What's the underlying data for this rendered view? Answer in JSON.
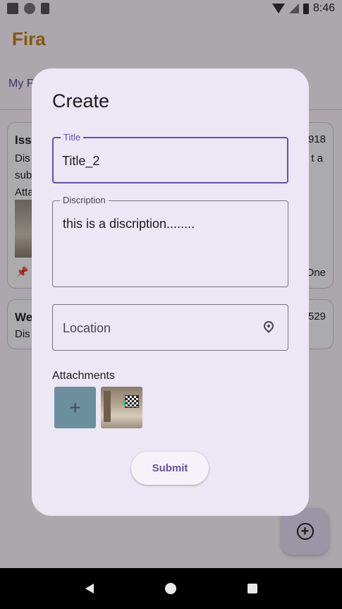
{
  "status_bar": {
    "time": "8:46"
  },
  "app": {
    "title": "Fira",
    "tab": "My F"
  },
  "background_cards": [
    {
      "title": "Iss",
      "number": "918",
      "line1": "Dis",
      "line1_end": "t a",
      "line2": "sub",
      "line3": "Atta",
      "status": "One"
    },
    {
      "title": "We",
      "number": "529",
      "line1": "Dis"
    }
  ],
  "dialog": {
    "title": "Create",
    "title_field": {
      "label": "Title",
      "value": "Title_2"
    },
    "description_field": {
      "label": "Discription",
      "value": "this is a discription........"
    },
    "location_field": {
      "placeholder": "Location",
      "icon": "location-pin-icon"
    },
    "attachments_label": "Attachments",
    "add_attachment_symbol": "+",
    "submit_label": "Submit"
  },
  "fab": {
    "icon": "add-circle-icon",
    "symbol": "+"
  },
  "colors": {
    "primary": "#6750a4",
    "app_title": "#c8801c",
    "dialog_bg": "#ede6f4",
    "add_tile": "#6b8f9c"
  }
}
